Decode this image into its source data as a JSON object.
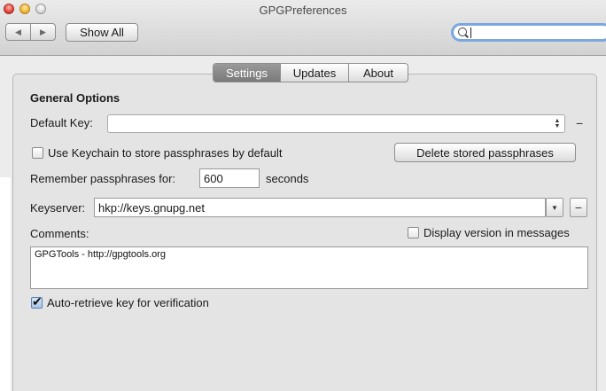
{
  "window": {
    "title": "GPGPreferences"
  },
  "toolbar": {
    "back_glyph": "◀",
    "forward_glyph": "▶",
    "show_all_label": "Show All",
    "search_placeholder": ""
  },
  "tabs": [
    {
      "label": "Settings",
      "selected": true
    },
    {
      "label": "Updates",
      "selected": false
    },
    {
      "label": "About",
      "selected": false
    }
  ],
  "general": {
    "heading": "General Options",
    "default_key_label": "Default Key:",
    "default_key_value": "",
    "remove_glyph": "−"
  },
  "keychain": {
    "label": "Use Keychain to store passphrases by default",
    "checked": false,
    "delete_button_label": "Delete stored passphrases"
  },
  "remember": {
    "label": "Remember passphrases for:",
    "value": "600",
    "unit": "seconds"
  },
  "keyserver": {
    "label": "Keyserver:",
    "value": "hkp://keys.gnupg.net",
    "arrow_glyph": "▼",
    "remove_glyph": "−"
  },
  "comments": {
    "label": "Comments:",
    "display_version_label": "Display version in messages",
    "display_version_checked": false,
    "text": "GPGTools - http://gpgtools.org"
  },
  "auto_retrieve": {
    "label": "Auto-retrieve key for verification",
    "checked": true
  },
  "colors": {
    "selected_tab": "#8a8a8a",
    "search_focus_ring": "#7aa7e0"
  }
}
